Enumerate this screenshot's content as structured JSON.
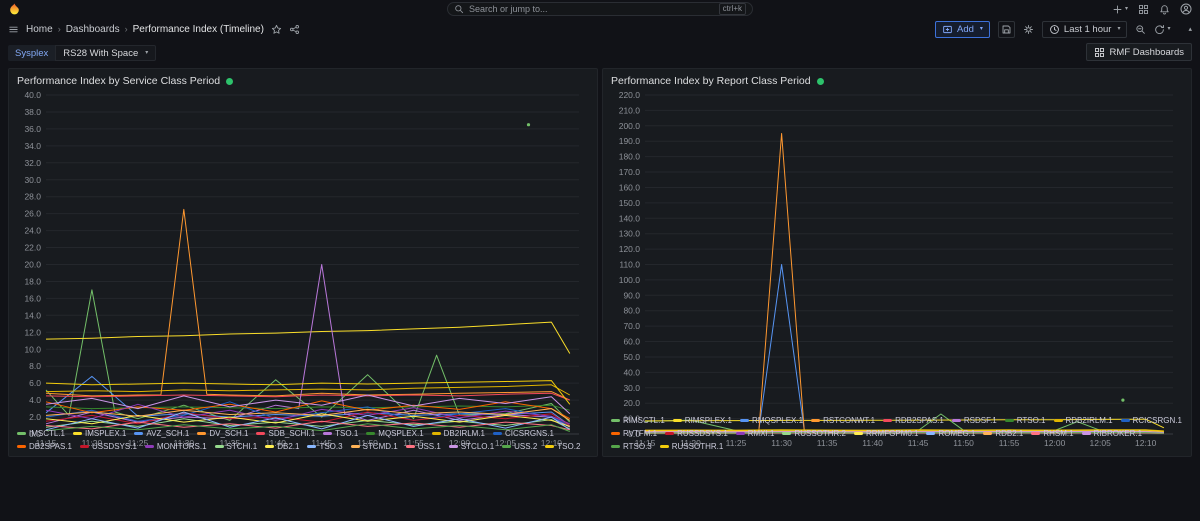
{
  "topbar": {
    "search_placeholder": "Search or jump to...",
    "search_shortcut": "ctrl+k"
  },
  "nav": {
    "breadcrumbs": [
      "Home",
      "Dashboards",
      "Performance Index (Timeline)"
    ]
  },
  "toolbar": {
    "add_label": "Add",
    "time_range_label": "Last 1 hour"
  },
  "variables": {
    "label": "Sysplex",
    "value": "RS28 With Space"
  },
  "dashboard_links": {
    "rmf_label": "RMF Dashboards"
  },
  "theme": {
    "background": "#111217",
    "panel_background": "#181b1f",
    "accent_blue": "#3d71d9",
    "health_green": "#2dc26b"
  },
  "chart_data": [
    {
      "type": "line",
      "title": "Performance Index by Service Class Period",
      "xlabel": "",
      "ylabel": "",
      "ylim": [
        0,
        40
      ],
      "ytick_step": 2,
      "xlim": [
        0,
        58
      ],
      "grid": true,
      "legend_position": "bottom",
      "x_minutes": [
        0,
        5,
        10,
        15,
        20,
        25,
        30,
        35,
        40,
        45,
        50,
        55,
        57
      ],
      "x_tick_minutes": [
        0,
        5,
        10,
        15,
        20,
        25,
        30,
        35,
        40,
        45,
        50,
        55
      ],
      "x_tick_labels": [
        "11:15",
        "11:20",
        "11:25",
        "11:30",
        "11:35",
        "11:40",
        "11:45",
        "11:50",
        "11:55",
        "12:00",
        "12:05",
        "12:10"
      ],
      "series": [
        {
          "name": "IMSCTL.1",
          "color": "#73BF69",
          "x": [
            0,
            2.5,
            5,
            7.5,
            10,
            15,
            20,
            25,
            30,
            35,
            40,
            42.5,
            45,
            50,
            55,
            57
          ],
          "values": [
            5.2,
            2.2,
            17.0,
            2.6,
            1.8,
            3.4,
            1.6,
            6.4,
            2.0,
            7.0,
            1.8,
            9.3,
            2.2,
            2.4,
            3.6,
            1.4
          ]
        },
        {
          "name": "IMSPLEX.1",
          "color": "#FADE2A",
          "values": [
            11.2,
            11.3,
            11.5,
            11.6,
            11.8,
            11.9,
            12.1,
            12.2,
            12.4,
            12.6,
            12.9,
            13.2,
            9.5
          ]
        },
        {
          "name": "AVZ_SCH.1",
          "color": "#5794F2",
          "values": [
            2.5,
            6.8,
            2.1,
            2.4,
            2.0,
            2.3,
            2.1,
            2.5,
            2.2,
            2.4,
            2.3,
            2.6,
            1.0
          ]
        },
        {
          "name": "DV_SCH.1",
          "color": "#FF9830",
          "x": [
            0,
            5,
            10,
            12.5,
            15,
            17.5,
            20,
            25,
            30,
            35,
            40,
            45,
            50,
            55,
            57
          ],
          "values": [
            4.8,
            4.5,
            4.6,
            4.6,
            26.5,
            4.7,
            4.6,
            4.5,
            4.8,
            4.6,
            4.7,
            4.8,
            4.9,
            5.0,
            4.0
          ]
        },
        {
          "name": "SDB_SCHI.1",
          "color": "#F2495C",
          "values": [
            4.5,
            4.4,
            4.5,
            4.6,
            4.5,
            4.4,
            4.6,
            4.5,
            4.6,
            4.5,
            4.7,
            4.8,
            4.0
          ]
        },
        {
          "name": "TSO.1",
          "color": "#B877D9",
          "x": [
            0,
            5,
            10,
            15,
            20,
            25,
            27.5,
            30,
            32.5,
            35,
            40,
            45,
            50,
            55,
            57
          ],
          "values": [
            1.2,
            2.6,
            1.4,
            2.0,
            1.8,
            3.4,
            3.0,
            20.0,
            2.4,
            1.6,
            2.8,
            1.6,
            2.3,
            2.0,
            0.8
          ]
        },
        {
          "name": "MQSPLEX.1",
          "color": "#37872D",
          "values": [
            3.2,
            3.0,
            3.1,
            3.2,
            3.1,
            3.0,
            3.2,
            3.1,
            3.2,
            3.3,
            3.2,
            3.4,
            2.8
          ]
        },
        {
          "name": "DB2IRLM.1",
          "color": "#E0B400",
          "values": [
            5.0,
            5.1,
            5.0,
            5.2,
            5.1,
            5.2,
            5.3,
            5.2,
            5.4,
            5.5,
            5.6,
            5.8,
            4.6
          ]
        },
        {
          "name": "CICSRGNS.1",
          "color": "#1F60C4",
          "values": [
            2.0,
            2.8,
            1.5,
            2.2,
            3.8,
            1.8,
            2.5,
            3.2,
            1.6,
            2.4,
            3.0,
            2.0,
            1.0
          ]
        },
        {
          "name": "DB2SPAS.1",
          "color": "#FA6400",
          "values": [
            3.8,
            2.5,
            3.2,
            2.8,
            3.5,
            2.6,
            3.9,
            2.8,
            3.4,
            2.9,
            3.8,
            3.0,
            1.8
          ]
        },
        {
          "name": "USSDSYS.1",
          "color": "#C4162A",
          "values": [
            1.5,
            2.2,
            1.2,
            2.5,
            1.8,
            2.0,
            1.4,
            2.6,
            1.6,
            2.2,
            1.8,
            2.4,
            1.0
          ]
        },
        {
          "name": "MONITORS.1",
          "color": "#8F3BB8",
          "values": [
            2.8,
            1.8,
            3.5,
            2.0,
            2.8,
            1.6,
            2.9,
            2.2,
            3.1,
            1.9,
            2.7,
            2.1,
            1.2
          ]
        },
        {
          "name": "STCHI.1",
          "color": "#96D98D",
          "values": [
            0.8,
            1.5,
            0.9,
            1.8,
            1.0,
            1.4,
            0.9,
            1.6,
            1.1,
            1.5,
            1.0,
            1.7,
            0.6
          ]
        },
        {
          "name": "DB2.1",
          "color": "#FFEE52",
          "values": [
            1.8,
            1.2,
            2.2,
            1.4,
            2.0,
            1.3,
            2.4,
            1.5,
            2.1,
            1.4,
            2.2,
            1.6,
            0.9
          ]
        },
        {
          "name": "TSO.3",
          "color": "#8AB8FF",
          "values": [
            0.5,
            1.8,
            0.7,
            2.6,
            0.8,
            1.9,
            0.6,
            2.2,
            0.9,
            1.8,
            0.7,
            2.0,
            0.5
          ]
        },
        {
          "name": "STCMD.1",
          "color": "#FFB357",
          "values": [
            2.2,
            2.6,
            2.1,
            2.8,
            2.3,
            2.5,
            2.2,
            2.9,
            2.4,
            2.6,
            2.3,
            3.0,
            1.6
          ]
        },
        {
          "name": "USS.1",
          "color": "#FF7383",
          "values": [
            1.0,
            0.6,
            1.4,
            0.8,
            1.2,
            0.7,
            1.5,
            0.9,
            1.3,
            0.8,
            1.4,
            1.0,
            0.5
          ]
        },
        {
          "name": "STCLO.1",
          "color": "#CA95E5",
          "values": [
            3.5,
            4.2,
            3.0,
            4.5,
            3.2,
            4.0,
            3.4,
            4.6,
            3.3,
            4.2,
            3.6,
            4.4,
            2.4
          ]
        },
        {
          "name": "USS.2",
          "color": "#56A64B",
          "values": [
            0.4,
            0.9,
            0.5,
            1.1,
            0.6,
            0.9,
            0.4,
            1.2,
            0.6,
            1.0,
            0.5,
            1.1,
            0.3
          ]
        },
        {
          "name": "TSO.2",
          "color": "#F2CC0C",
          "values": [
            6.0,
            5.8,
            5.9,
            6.0,
            5.9,
            5.8,
            6.0,
            5.9,
            6.0,
            6.1,
            6.2,
            6.3,
            3.5
          ]
        }
      ],
      "points": [
        {
          "x": 52.5,
          "y": 36.5,
          "color": "#73BF69"
        }
      ]
    },
    {
      "type": "line",
      "title": "Performance Index by Report Class Period",
      "xlabel": "",
      "ylabel": "",
      "ylim": [
        0,
        220
      ],
      "ytick_step": 10,
      "xlim": [
        0,
        58
      ],
      "grid": true,
      "legend_position": "bottom",
      "x_minutes": [
        0,
        5,
        10,
        15,
        20,
        25,
        30,
        35,
        40,
        45,
        50,
        55,
        57
      ],
      "x_tick_minutes": [
        0,
        5,
        10,
        15,
        20,
        25,
        30,
        35,
        40,
        45,
        50,
        55
      ],
      "x_tick_labels": [
        "11:15",
        "11:20",
        "11:25",
        "11:30",
        "11:35",
        "11:40",
        "11:45",
        "11:50",
        "11:55",
        "12:00",
        "12:05",
        "12:10"
      ],
      "series": [
        {
          "name": "RIMSCTL.1",
          "color": "#73BF69",
          "x": [
            0,
            5,
            10,
            15,
            20,
            25,
            30,
            32.5,
            35,
            40,
            45,
            47.5,
            50,
            55,
            57
          ],
          "values": [
            8.2,
            9.0,
            2.2,
            2.5,
            2.1,
            2.3,
            2.2,
            13.0,
            2.4,
            2.2,
            2.3,
            8.0,
            2.4,
            2.6,
            1.5
          ]
        },
        {
          "name": "RIMSPLEX.1",
          "color": "#FADE2A",
          "values": [
            8.5,
            8.6,
            8.7,
            8.8,
            8.8,
            8.9,
            9.0,
            9.1,
            9.2,
            9.3,
            9.5,
            9.6,
            4.0
          ]
        },
        {
          "name": "RMQSPLEX.1",
          "color": "#5794F2",
          "x": [
            0,
            5,
            10,
            12.5,
            15,
            17.5,
            20,
            25,
            30,
            35,
            40,
            45,
            50,
            55,
            57
          ],
          "values": [
            2.0,
            2.2,
            2.1,
            2.2,
            110.0,
            2.3,
            2.2,
            2.4,
            2.3,
            2.2,
            2.4,
            2.3,
            2.4,
            2.5,
            1.5
          ]
        },
        {
          "name": "RSTCONWT.1",
          "color": "#FF9830",
          "x": [
            0,
            5,
            10,
            12.5,
            15,
            17.5,
            20,
            25,
            30,
            35,
            40,
            45,
            50,
            55,
            57
          ],
          "values": [
            1.5,
            1.6,
            1.5,
            1.6,
            195.0,
            1.8,
            1.6,
            1.7,
            1.8,
            1.6,
            1.8,
            1.7,
            1.9,
            1.8,
            1.2
          ]
        },
        {
          "name": "RDB2SPAS.1",
          "color": "#F2495C",
          "values": [
            1.2,
            1.3,
            1.2,
            1.4,
            1.3,
            1.2,
            1.4,
            1.3,
            1.4,
            1.3,
            1.5,
            1.4,
            1.0
          ]
        },
        {
          "name": "RSDSF.1",
          "color": "#B877D9",
          "values": [
            0.8,
            1.0,
            0.9,
            1.1,
            1.0,
            0.9,
            1.1,
            1.0,
            1.1,
            1.0,
            1.2,
            1.1,
            0.7
          ]
        },
        {
          "name": "RTSO.1",
          "color": "#37872D",
          "values": [
            1.8,
            1.9,
            1.8,
            2.0,
            1.9,
            1.8,
            2.0,
            1.9,
            2.0,
            1.9,
            2.1,
            2.0,
            1.4
          ]
        },
        {
          "name": "RDB2IRLM.1",
          "color": "#E0B400",
          "values": [
            2.5,
            2.6,
            2.5,
            2.7,
            2.6,
            2.5,
            2.7,
            2.6,
            2.7,
            2.6,
            2.8,
            2.7,
            2.0
          ]
        },
        {
          "name": "RCICSRGN.1",
          "color": "#1F60C4",
          "values": [
            1.0,
            1.2,
            1.0,
            1.3,
            1.1,
            1.0,
            1.2,
            1.1,
            1.2,
            1.1,
            1.3,
            1.2,
            0.8
          ]
        },
        {
          "name": "RVTFM.1",
          "color": "#FA6400",
          "values": [
            0.6,
            0.7,
            0.6,
            0.8,
            0.7,
            0.6,
            0.8,
            0.7,
            0.8,
            0.7,
            0.9,
            0.8,
            0.5
          ]
        },
        {
          "name": "RUSSDSYS.1",
          "color": "#C4162A",
          "values": [
            1.4,
            1.5,
            1.4,
            1.6,
            1.5,
            1.4,
            1.6,
            1.5,
            1.6,
            1.5,
            1.7,
            1.6,
            1.1
          ]
        },
        {
          "name": "RMXI.1",
          "color": "#8F3BB8",
          "values": [
            0.9,
            1.0,
            0.9,
            1.1,
            1.0,
            0.9,
            1.1,
            1.0,
            1.1,
            1.0,
            1.2,
            1.1,
            0.7
          ]
        },
        {
          "name": "RUSSOTHR.2",
          "color": "#96D98D",
          "values": [
            0.5,
            0.6,
            0.5,
            0.7,
            0.6,
            0.5,
            0.7,
            0.6,
            0.7,
            0.6,
            0.8,
            0.7,
            0.4
          ]
        },
        {
          "name": "RRMFGPM0.1",
          "color": "#FFEE52",
          "values": [
            1.1,
            1.2,
            1.1,
            1.3,
            1.2,
            1.1,
            1.3,
            1.2,
            1.3,
            1.2,
            1.4,
            1.3,
            0.9
          ]
        },
        {
          "name": "ROMEG.1",
          "color": "#8AB8FF",
          "values": [
            0.7,
            0.8,
            0.7,
            0.9,
            0.8,
            0.7,
            0.9,
            0.8,
            0.9,
            0.8,
            1.0,
            0.9,
            0.6
          ]
        },
        {
          "name": "RDB2.1",
          "color": "#FFB357",
          "values": [
            1.6,
            1.7,
            1.6,
            1.8,
            1.7,
            1.6,
            1.8,
            1.7,
            1.8,
            1.7,
            1.9,
            1.8,
            1.2
          ]
        },
        {
          "name": "RHSM.1",
          "color": "#FF7383",
          "values": [
            0.4,
            0.5,
            0.4,
            0.6,
            0.5,
            0.4,
            0.6,
            0.5,
            0.6,
            0.5,
            0.7,
            0.6,
            0.3
          ]
        },
        {
          "name": "RIBROKER.1",
          "color": "#CA95E5",
          "values": [
            1.3,
            1.4,
            1.3,
            1.5,
            1.4,
            1.3,
            1.5,
            1.4,
            1.5,
            1.4,
            1.6,
            1.5,
            1.0
          ]
        },
        {
          "name": "RTSO.3",
          "color": "#56A64B",
          "values": [
            0.6,
            0.7,
            0.6,
            0.8,
            0.7,
            0.6,
            0.8,
            0.7,
            0.8,
            0.7,
            0.9,
            0.8,
            0.5
          ]
        },
        {
          "name": "RUSSOTHR.1",
          "color": "#F2CC0C",
          "values": [
            2.2,
            2.3,
            2.2,
            2.4,
            2.3,
            2.2,
            2.4,
            2.3,
            2.4,
            2.3,
            2.5,
            2.4,
            1.7
          ]
        }
      ],
      "points": [
        {
          "x": 52.5,
          "y": 22.0,
          "color": "#73BF69"
        }
      ]
    }
  ]
}
